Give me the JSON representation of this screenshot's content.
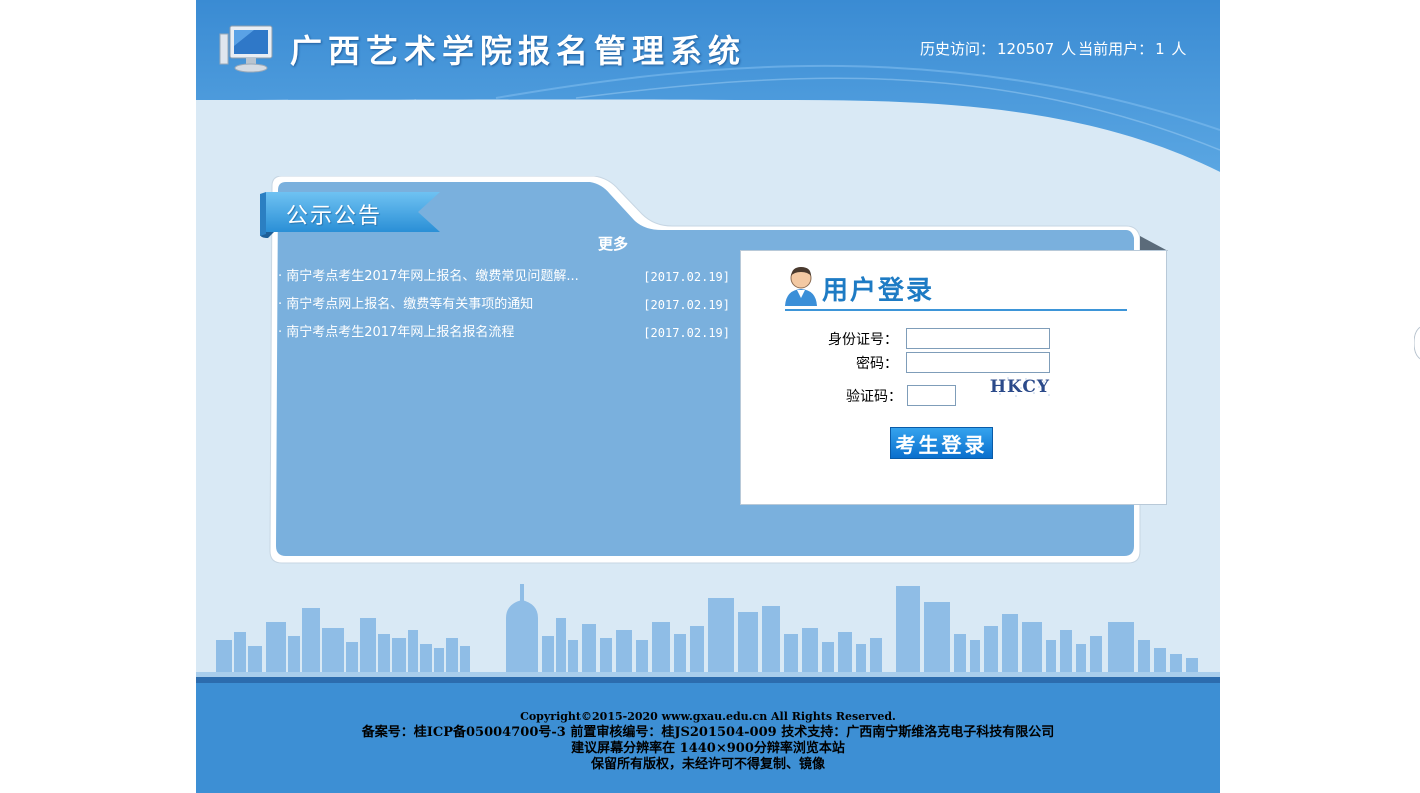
{
  "header": {
    "title": "广西艺术学院报名管理系统",
    "history_visits_label": "历史访问：",
    "history_visits": "120507",
    "history_unit": "人",
    "current_users_label": "当前用户：",
    "current_users": "1",
    "current_unit": "人"
  },
  "notice": {
    "tab_label": "公示公告",
    "more_label": "更多",
    "items": [
      {
        "title": "· 南宁考点考生2017年网上报名、缴费常见问题解...",
        "date": "[2017.02.19]"
      },
      {
        "title": "· 南宁考点网上报名、缴费等有关事项的通知",
        "date": "[2017.02.19]"
      },
      {
        "title": "· 南宁考点考生2017年网上报名报名流程",
        "date": "[2017.02.19]"
      }
    ]
  },
  "login": {
    "title": "用户登录",
    "id_label": "身份证号：",
    "id_value": "",
    "password_label": "密码：",
    "password_value": "",
    "captcha_label": "验证码：",
    "captcha_value": "",
    "captcha_text": "HKCY",
    "button_label": "考生登录"
  },
  "footer": {
    "copyright": "Copyright©2015-2020 www.gxau.edu.cn All Rights Reserved.",
    "record": "备案号：桂ICP备05004700号-3 前置审核编号：桂JS201504-009 技术支持：广西南宁斯维洛克电子科技有限公司",
    "resolution": "建议屏幕分辨率在 1440×900分辩率浏览本站",
    "rights": "保留所有版权，未经许可不得复制、镜像"
  },
  "colors": {
    "header_blue": "#3f8fd6",
    "page_bg": "#d9e9f5",
    "panel_blue": "#7ab0dd",
    "title_blue": "#1e7bc4",
    "footer_blue": "#3d8fd4"
  }
}
